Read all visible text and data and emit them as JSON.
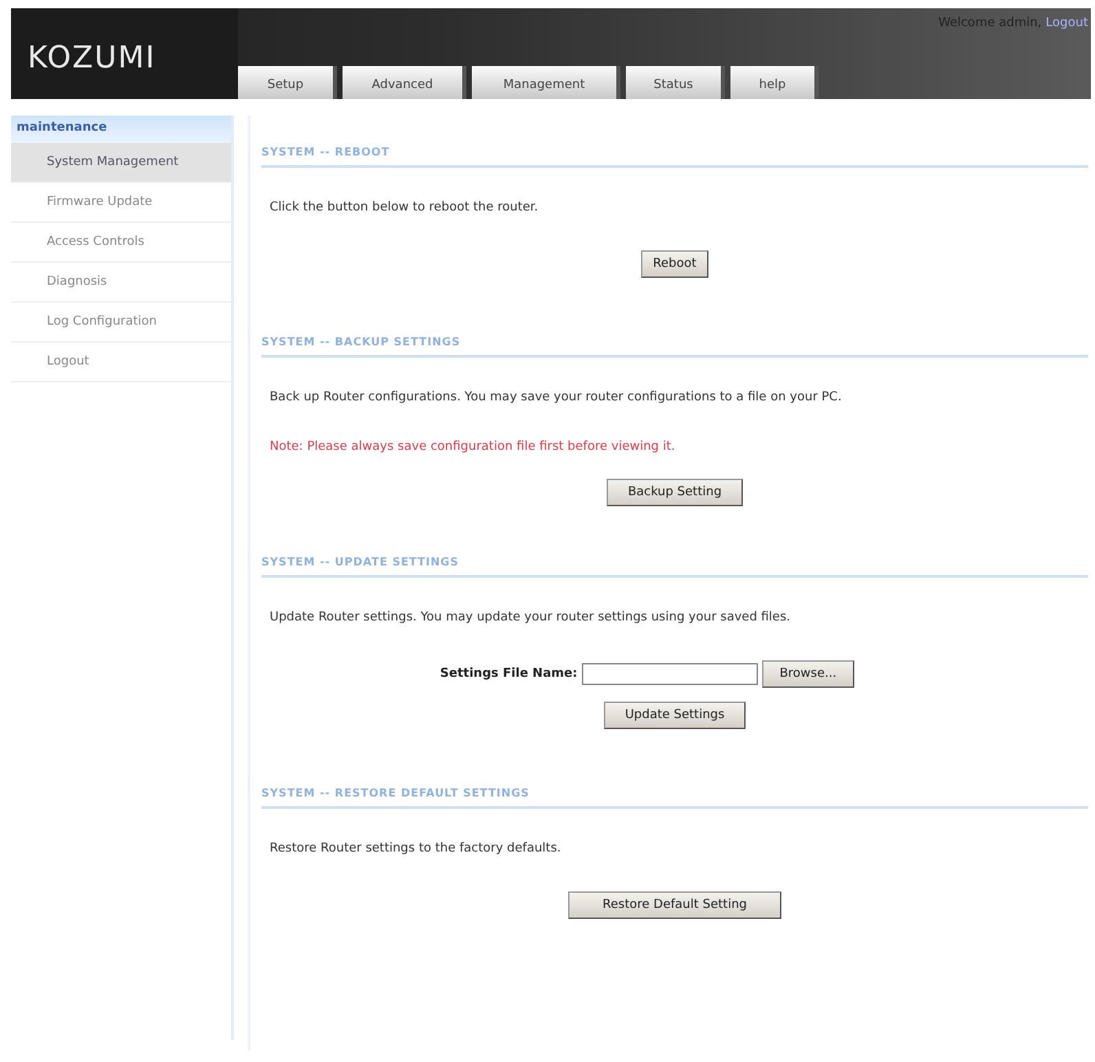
{
  "header": {
    "logo": "KOZUMI",
    "welcome": "Welcome admin,",
    "logout": "Logout"
  },
  "tabs": [
    {
      "label": "Setup",
      "selected": false
    },
    {
      "label": "Advanced",
      "selected": false
    },
    {
      "label": "Management",
      "selected": false
    },
    {
      "label": "Status",
      "selected": false
    },
    {
      "label": "help",
      "selected": false
    }
  ],
  "sidebar": {
    "title": "maintenance",
    "items": [
      {
        "label": "System Management",
        "selected": true
      },
      {
        "label": "Firmware Update",
        "selected": false
      },
      {
        "label": "Access Controls",
        "selected": false
      },
      {
        "label": "Diagnosis",
        "selected": false
      },
      {
        "label": "Log Configuration",
        "selected": false
      },
      {
        "label": "Logout",
        "selected": false
      }
    ]
  },
  "sections": [
    {
      "title": "SYSTEM -- REBOOT",
      "items": [
        {
          "kind": "text",
          "text": "Click the button below to reboot the router."
        },
        {
          "kind": "button",
          "label": "Reboot"
        }
      ]
    },
    {
      "title": "SYSTEM -- BACKUP SETTINGS",
      "items": [
        {
          "kind": "text",
          "text": "Back up Router configurations. You may save your router configurations to a file on your PC."
        },
        {
          "kind": "note",
          "text": "Note: Please always save configuration file first before viewing it."
        },
        {
          "kind": "button",
          "label": "Backup Setting"
        }
      ]
    },
    {
      "title": "SYSTEM -- UPDATE SETTINGS",
      "items": [
        {
          "kind": "text",
          "text": "Update Router settings. You may update your router settings using your saved files."
        },
        {
          "kind": "file",
          "label": "Settings File Name:",
          "button": "Browse..."
        },
        {
          "kind": "button",
          "label": "Update Settings"
        }
      ]
    },
    {
      "title": "SYSTEM -- RESTORE DEFAULT SETTINGS",
      "items": [
        {
          "kind": "text",
          "text": "Restore Router settings to the factory defaults."
        },
        {
          "kind": "button",
          "label": "Restore Default Setting"
        }
      ]
    }
  ]
}
